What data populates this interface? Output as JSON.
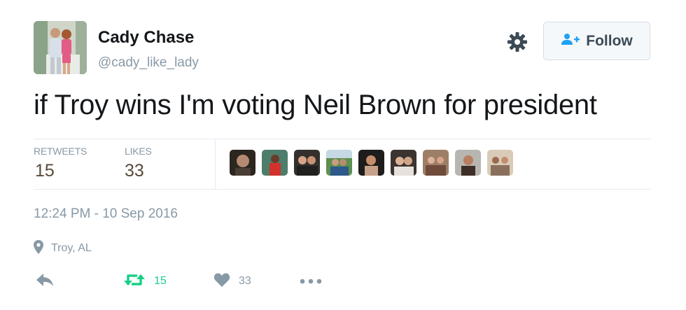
{
  "user": {
    "display_name": "Cady Chase",
    "handle": "@cady_like_lady"
  },
  "header": {
    "settings_icon": "gear-icon",
    "follow_label": "Follow",
    "follow_icon": "add-user-icon"
  },
  "tweet": {
    "text": "if Troy wins I'm voting Neil Brown for president",
    "timestamp": "12:24 PM - 10 Sep 2016",
    "location": "Troy, AL"
  },
  "stats": {
    "retweets_label": "RETWEETS",
    "retweets_value": "15",
    "likes_label": "LIKES",
    "likes_value": "33"
  },
  "actions": {
    "reply_icon": "reply-icon",
    "retweet_icon": "retweet-icon",
    "retweet_count": "15",
    "like_icon": "heart-icon",
    "like_count": "33",
    "more_icon": "more-icon"
  },
  "colors": {
    "retweet_green": "#19cf86",
    "muted": "#8899a6",
    "follow_icon_blue": "#1da1f2"
  }
}
